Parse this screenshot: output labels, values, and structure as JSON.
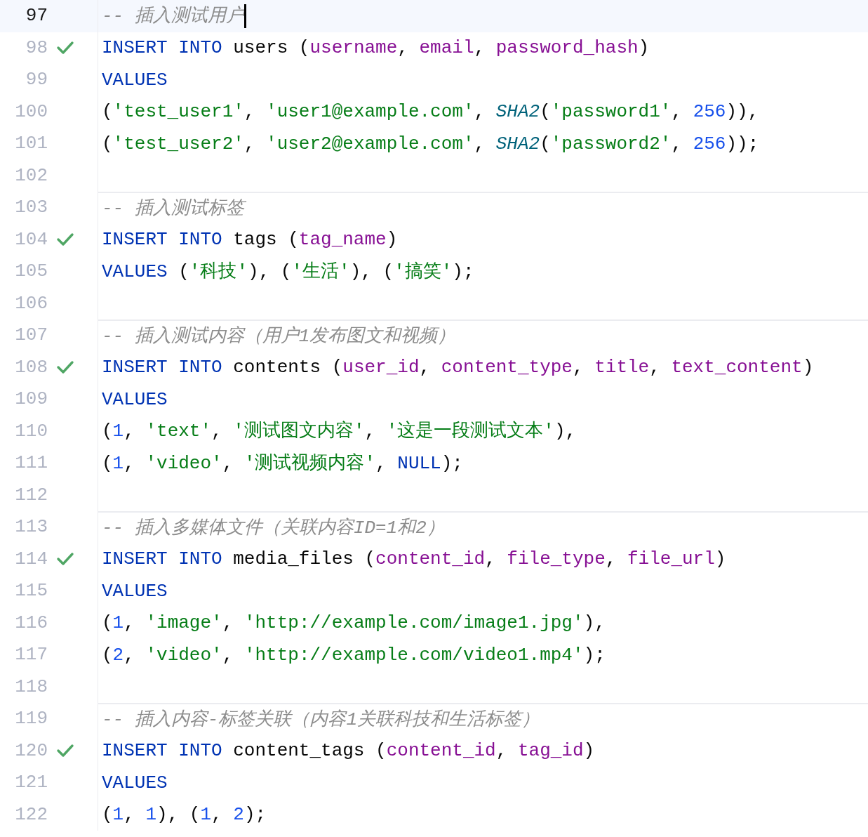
{
  "editor": {
    "lines": [
      {
        "number": "97",
        "current": true,
        "ok": false,
        "separator": false,
        "caret": true,
        "tokens": [
          {
            "kind": "comment",
            "text": "-- 插入测试用户"
          }
        ]
      },
      {
        "number": "98",
        "current": false,
        "ok": true,
        "separator": false,
        "caret": false,
        "tokens": [
          {
            "kind": "keyword",
            "text": "INSERT INTO"
          },
          {
            "kind": "plain",
            "text": " users ("
          },
          {
            "kind": "column",
            "text": "username"
          },
          {
            "kind": "plain",
            "text": ", "
          },
          {
            "kind": "column",
            "text": "email"
          },
          {
            "kind": "plain",
            "text": ", "
          },
          {
            "kind": "column",
            "text": "password_hash"
          },
          {
            "kind": "plain",
            "text": ")"
          }
        ]
      },
      {
        "number": "99",
        "current": false,
        "ok": false,
        "separator": false,
        "caret": false,
        "tokens": [
          {
            "kind": "keyword",
            "text": "VALUES"
          }
        ]
      },
      {
        "number": "100",
        "current": false,
        "ok": false,
        "separator": false,
        "caret": false,
        "tokens": [
          {
            "kind": "plain",
            "text": "("
          },
          {
            "kind": "string",
            "text": "'test_user1'"
          },
          {
            "kind": "plain",
            "text": ", "
          },
          {
            "kind": "string",
            "text": "'user1@example.com'"
          },
          {
            "kind": "plain",
            "text": ", "
          },
          {
            "kind": "func",
            "text": "SHA2"
          },
          {
            "kind": "plain",
            "text": "("
          },
          {
            "kind": "string",
            "text": "'password1'"
          },
          {
            "kind": "plain",
            "text": ", "
          },
          {
            "kind": "number",
            "text": "256"
          },
          {
            "kind": "plain",
            "text": ")),"
          }
        ]
      },
      {
        "number": "101",
        "current": false,
        "ok": false,
        "separator": false,
        "caret": false,
        "tokens": [
          {
            "kind": "plain",
            "text": "("
          },
          {
            "kind": "string",
            "text": "'test_user2'"
          },
          {
            "kind": "plain",
            "text": ", "
          },
          {
            "kind": "string",
            "text": "'user2@example.com'"
          },
          {
            "kind": "plain",
            "text": ", "
          },
          {
            "kind": "func",
            "text": "SHA2"
          },
          {
            "kind": "plain",
            "text": "("
          },
          {
            "kind": "string",
            "text": "'password2'"
          },
          {
            "kind": "plain",
            "text": ", "
          },
          {
            "kind": "number",
            "text": "256"
          },
          {
            "kind": "plain",
            "text": "));"
          }
        ]
      },
      {
        "number": "102",
        "current": false,
        "ok": false,
        "separator": false,
        "caret": false
      },
      {
        "number": "103",
        "current": false,
        "ok": false,
        "separator": true,
        "caret": false,
        "tokens": [
          {
            "kind": "comment",
            "text": "-- 插入测试标签"
          }
        ]
      },
      {
        "number": "104",
        "current": false,
        "ok": true,
        "separator": false,
        "caret": false,
        "tokens": [
          {
            "kind": "keyword",
            "text": "INSERT INTO"
          },
          {
            "kind": "plain",
            "text": " tags ("
          },
          {
            "kind": "column",
            "text": "tag_name"
          },
          {
            "kind": "plain",
            "text": ")"
          }
        ]
      },
      {
        "number": "105",
        "current": false,
        "ok": false,
        "separator": false,
        "caret": false,
        "tokens": [
          {
            "kind": "keyword",
            "text": "VALUES"
          },
          {
            "kind": "plain",
            "text": " ("
          },
          {
            "kind": "string",
            "text": "'科技'"
          },
          {
            "kind": "plain",
            "text": "), ("
          },
          {
            "kind": "string",
            "text": "'生活'"
          },
          {
            "kind": "plain",
            "text": "), ("
          },
          {
            "kind": "string",
            "text": "'搞笑'"
          },
          {
            "kind": "plain",
            "text": ");"
          }
        ]
      },
      {
        "number": "106",
        "current": false,
        "ok": false,
        "separator": false,
        "caret": false
      },
      {
        "number": "107",
        "current": false,
        "ok": false,
        "separator": true,
        "caret": false,
        "tokens": [
          {
            "kind": "comment",
            "text": "-- 插入测试内容（用户1发布图文和视频）"
          }
        ]
      },
      {
        "number": "108",
        "current": false,
        "ok": true,
        "separator": false,
        "caret": false,
        "tokens": [
          {
            "kind": "keyword",
            "text": "INSERT INTO"
          },
          {
            "kind": "plain",
            "text": " contents ("
          },
          {
            "kind": "column",
            "text": "user_id"
          },
          {
            "kind": "plain",
            "text": ", "
          },
          {
            "kind": "column",
            "text": "content_type"
          },
          {
            "kind": "plain",
            "text": ", "
          },
          {
            "kind": "column",
            "text": "title"
          },
          {
            "kind": "plain",
            "text": ", "
          },
          {
            "kind": "column",
            "text": "text_content"
          },
          {
            "kind": "plain",
            "text": ")"
          }
        ]
      },
      {
        "number": "109",
        "current": false,
        "ok": false,
        "separator": false,
        "caret": false,
        "tokens": [
          {
            "kind": "keyword",
            "text": "VALUES"
          }
        ]
      },
      {
        "number": "110",
        "current": false,
        "ok": false,
        "separator": false,
        "caret": false,
        "tokens": [
          {
            "kind": "plain",
            "text": "("
          },
          {
            "kind": "number",
            "text": "1"
          },
          {
            "kind": "plain",
            "text": ", "
          },
          {
            "kind": "string",
            "text": "'text'"
          },
          {
            "kind": "plain",
            "text": ", "
          },
          {
            "kind": "string",
            "text": "'测试图文内容'"
          },
          {
            "kind": "plain",
            "text": ", "
          },
          {
            "kind": "string",
            "text": "'这是一段测试文本'"
          },
          {
            "kind": "plain",
            "text": "),"
          }
        ]
      },
      {
        "number": "111",
        "current": false,
        "ok": false,
        "separator": false,
        "caret": false,
        "tokens": [
          {
            "kind": "plain",
            "text": "("
          },
          {
            "kind": "number",
            "text": "1"
          },
          {
            "kind": "plain",
            "text": ", "
          },
          {
            "kind": "string",
            "text": "'video'"
          },
          {
            "kind": "plain",
            "text": ", "
          },
          {
            "kind": "string",
            "text": "'测试视频内容'"
          },
          {
            "kind": "plain",
            "text": ", "
          },
          {
            "kind": "keyword",
            "text": "NULL"
          },
          {
            "kind": "plain",
            "text": ");"
          }
        ]
      },
      {
        "number": "112",
        "current": false,
        "ok": false,
        "separator": false,
        "caret": false
      },
      {
        "number": "113",
        "current": false,
        "ok": false,
        "separator": true,
        "caret": false,
        "tokens": [
          {
            "kind": "comment",
            "text": "-- 插入多媒体文件（关联内容ID=1和2）"
          }
        ]
      },
      {
        "number": "114",
        "current": false,
        "ok": true,
        "separator": false,
        "caret": false,
        "tokens": [
          {
            "kind": "keyword",
            "text": "INSERT INTO"
          },
          {
            "kind": "plain",
            "text": " media_files ("
          },
          {
            "kind": "column",
            "text": "content_id"
          },
          {
            "kind": "plain",
            "text": ", "
          },
          {
            "kind": "column",
            "text": "file_type"
          },
          {
            "kind": "plain",
            "text": ", "
          },
          {
            "kind": "column",
            "text": "file_url"
          },
          {
            "kind": "plain",
            "text": ")"
          }
        ]
      },
      {
        "number": "115",
        "current": false,
        "ok": false,
        "separator": false,
        "caret": false,
        "tokens": [
          {
            "kind": "keyword",
            "text": "VALUES"
          }
        ]
      },
      {
        "number": "116",
        "current": false,
        "ok": false,
        "separator": false,
        "caret": false,
        "tokens": [
          {
            "kind": "plain",
            "text": "("
          },
          {
            "kind": "number",
            "text": "1"
          },
          {
            "kind": "plain",
            "text": ", "
          },
          {
            "kind": "string",
            "text": "'image'"
          },
          {
            "kind": "plain",
            "text": ", "
          },
          {
            "kind": "string",
            "text": "'http://example.com/image1.jpg'"
          },
          {
            "kind": "plain",
            "text": "),"
          }
        ]
      },
      {
        "number": "117",
        "current": false,
        "ok": false,
        "separator": false,
        "caret": false,
        "tokens": [
          {
            "kind": "plain",
            "text": "("
          },
          {
            "kind": "number",
            "text": "2"
          },
          {
            "kind": "plain",
            "text": ", "
          },
          {
            "kind": "string",
            "text": "'video'"
          },
          {
            "kind": "plain",
            "text": ", "
          },
          {
            "kind": "string",
            "text": "'http://example.com/video1.mp4'"
          },
          {
            "kind": "plain",
            "text": ");"
          }
        ]
      },
      {
        "number": "118",
        "current": false,
        "ok": false,
        "separator": false,
        "caret": false
      },
      {
        "number": "119",
        "current": false,
        "ok": false,
        "separator": true,
        "caret": false,
        "tokens": [
          {
            "kind": "comment",
            "text": "-- 插入内容-标签关联（内容1关联科技和生活标签）"
          }
        ]
      },
      {
        "number": "120",
        "current": false,
        "ok": true,
        "separator": false,
        "caret": false,
        "tokens": [
          {
            "kind": "keyword",
            "text": "INSERT INTO"
          },
          {
            "kind": "plain",
            "text": " content_tags ("
          },
          {
            "kind": "column",
            "text": "content_id"
          },
          {
            "kind": "plain",
            "text": ", "
          },
          {
            "kind": "column",
            "text": "tag_id"
          },
          {
            "kind": "plain",
            "text": ")"
          }
        ]
      },
      {
        "number": "121",
        "current": false,
        "ok": false,
        "separator": false,
        "caret": false,
        "tokens": [
          {
            "kind": "keyword",
            "text": "VALUES"
          }
        ]
      },
      {
        "number": "122",
        "current": false,
        "ok": false,
        "separator": false,
        "caret": false,
        "tokens": [
          {
            "kind": "plain",
            "text": "("
          },
          {
            "kind": "number",
            "text": "1"
          },
          {
            "kind": "plain",
            "text": ", "
          },
          {
            "kind": "number",
            "text": "1"
          },
          {
            "kind": "plain",
            "text": "), ("
          },
          {
            "kind": "number",
            "text": "1"
          },
          {
            "kind": "plain",
            "text": ", "
          },
          {
            "kind": "number",
            "text": "2"
          },
          {
            "kind": "plain",
            "text": ");"
          }
        ]
      }
    ]
  }
}
